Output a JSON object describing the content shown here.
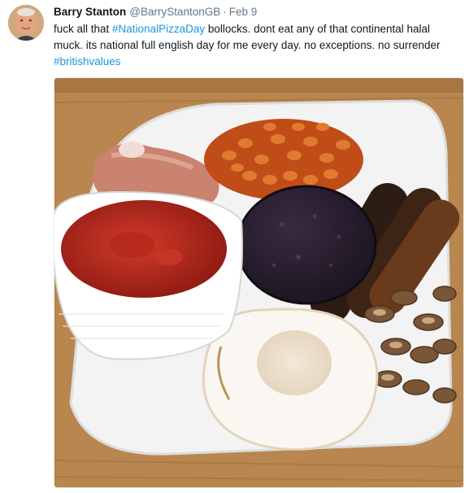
{
  "tweet": {
    "author": {
      "display_name": "Barry Stanton",
      "handle": "@BarryStantonGB"
    },
    "separator": "·",
    "date": "Feb 9",
    "text": {
      "part1": "fuck all that ",
      "hashtag1": "#NationalPizzaDay",
      "part2": " bollocks. dont eat any of that continental halal muck. its national full english day for me every day. no exceptions. no surrender ",
      "hashtag2": "#britishvalues"
    },
    "media": {
      "icon": "breakfast-photo-icon"
    }
  },
  "colors": {
    "link": "#1b95e0",
    "name": "#14171a",
    "meta": "#657786",
    "table": "#b8864e",
    "plate": "#f4f4f4"
  }
}
